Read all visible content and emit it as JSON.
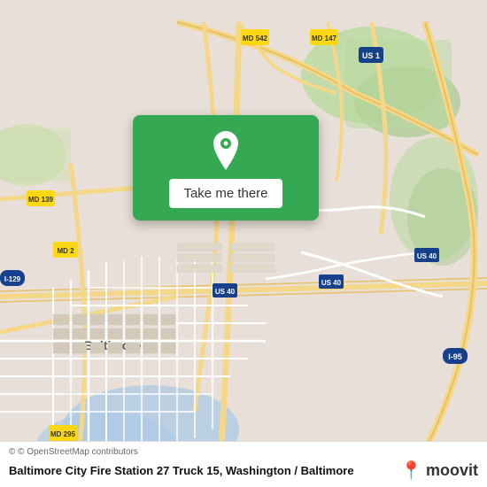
{
  "map": {
    "bg_color": "#e8e0d8",
    "center_lat": 39.29,
    "center_lng": -76.61
  },
  "overlay": {
    "button_label": "Take me there",
    "button_bg": "#34a853",
    "pin_color": "#ffffff"
  },
  "attribution": {
    "text": "© OpenStreetMap contributors"
  },
  "place": {
    "name": "Baltimore City Fire Station 27 Truck 15, Washington / Baltimore"
  },
  "moovit": {
    "logo_text": "moovit",
    "icon": "🔴"
  }
}
